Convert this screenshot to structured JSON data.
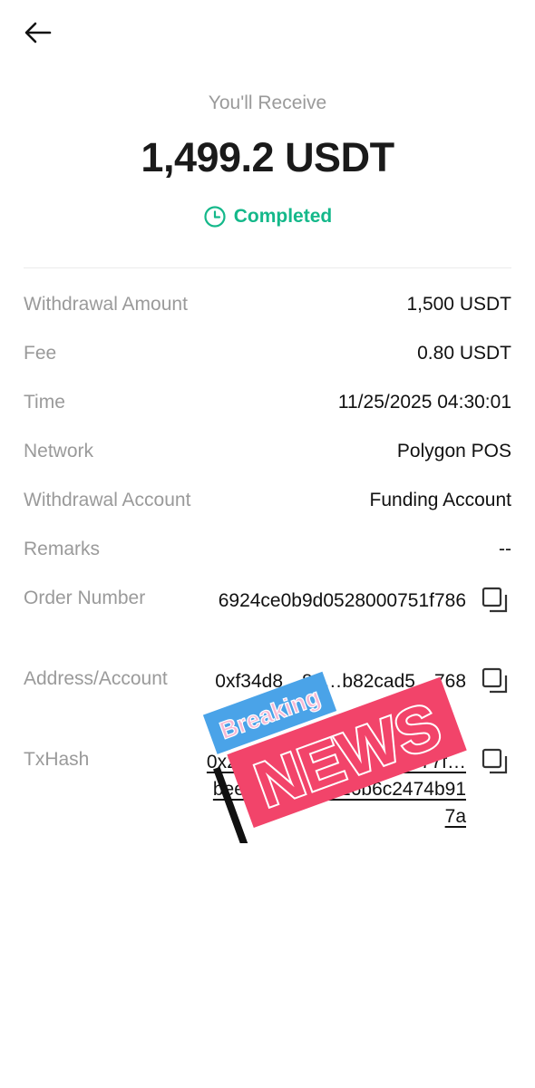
{
  "header": {
    "back_icon": "arrow-left-icon"
  },
  "summary": {
    "subtitle": "You'll Receive",
    "amount": "1,499.2 USDT",
    "status": "Completed",
    "status_icon": "clock-icon",
    "status_color": "#14b88a"
  },
  "details": {
    "withdrawal_amount": {
      "label": "Withdrawal Amount",
      "value": "1,500 USDT"
    },
    "fee": {
      "label": "Fee",
      "value": "0.80 USDT"
    },
    "time": {
      "label": "Time",
      "value": "11/25/2025 04:30:01"
    },
    "network": {
      "label": "Network",
      "value": "Polygon POS"
    },
    "withdrawal_account": {
      "label": "Withdrawal Account",
      "value": "Funding Account"
    },
    "remarks": {
      "label": "Remarks",
      "value": "--"
    },
    "order_number": {
      "label": "Order Number",
      "value": "6924ce0b9d0528000751f786"
    },
    "address": {
      "label": "Address/Account",
      "value": "0xf34d8…82…b82cad5…768"
    },
    "txhash": {
      "label": "TxHash",
      "value": "0x2369…5995daef6e28e77f…bee52dd07e8816b6c2474b917a"
    }
  },
  "overlay": {
    "line1": "Breaking",
    "line2": "NEWS",
    "colors": {
      "blue": "#4aa3e8",
      "red": "#f2446a",
      "black": "#111111"
    }
  }
}
